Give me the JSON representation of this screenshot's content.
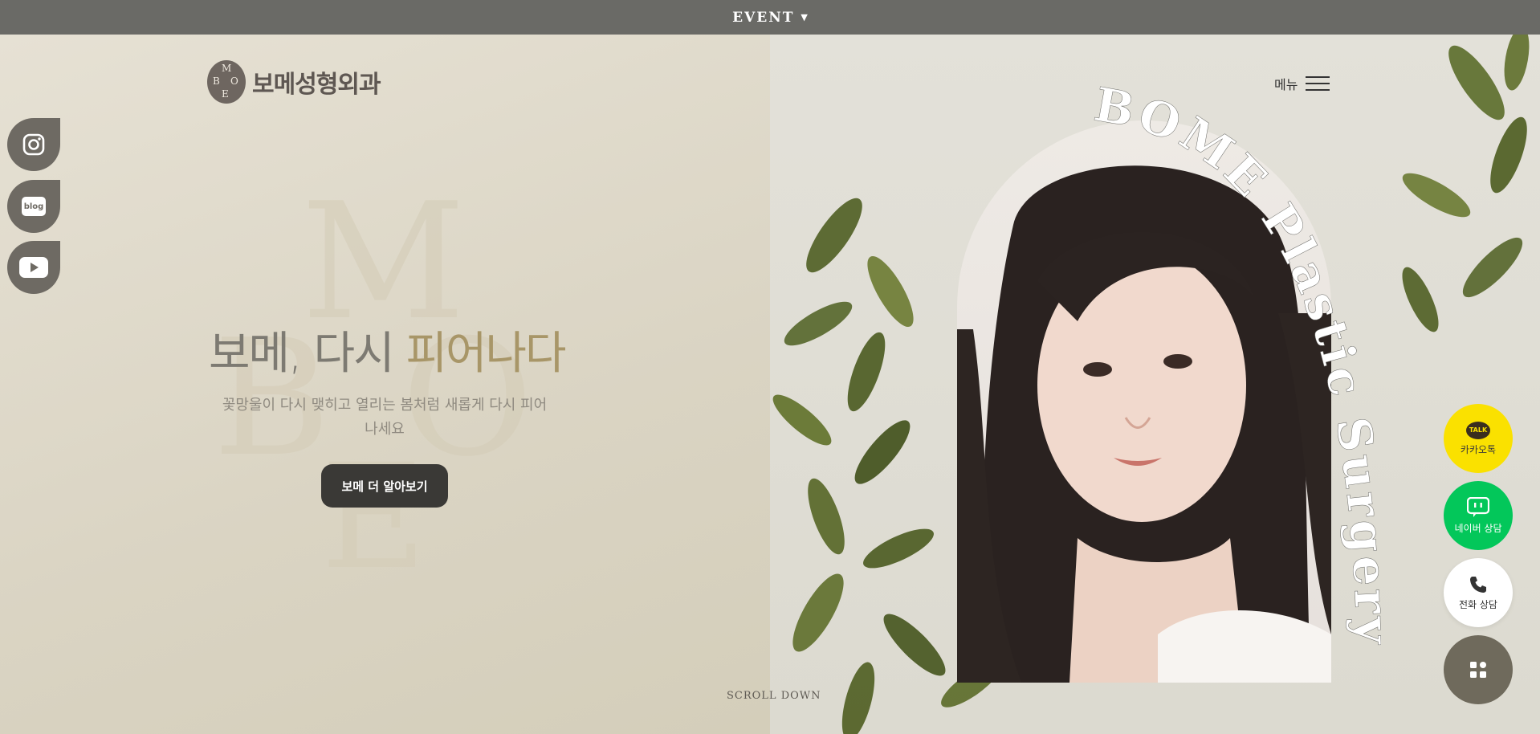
{
  "topbar": {
    "label": "EVENT"
  },
  "logo": {
    "mark_letters": [
      "M",
      "B",
      "O",
      "E"
    ],
    "name": "보메성형외과"
  },
  "menu": {
    "label": "메뉴"
  },
  "social": [
    {
      "icon": "instagram-icon"
    },
    {
      "icon": "blog-icon",
      "icon_text": "blog"
    },
    {
      "icon": "youtube-icon"
    }
  ],
  "hero": {
    "title_part1": "보메, 다시 ",
    "title_part2": "피어나다",
    "subtitle": "꽃망울이 다시 맺히고 열리는 봄처럼 새롭게 다시 피어나세요",
    "cta": "보메 더 알아보기"
  },
  "watermark": {
    "letters": [
      "M",
      "B",
      "O",
      "E"
    ]
  },
  "arc_text": "BOME Plastic Surgery",
  "scroll": {
    "label": "SCROLL DOWN"
  },
  "quick_menu": {
    "kakao": {
      "badge": "TALK",
      "label": "카카오톡"
    },
    "naver": {
      "label": "네이버 상담"
    },
    "phone": {
      "label": "전화 상담"
    }
  },
  "colors": {
    "topbar": "#6a6a66",
    "accent_gold": "#a89668",
    "kakao": "#fae100",
    "naver": "#03c75a",
    "dark_button": "#3a3936"
  }
}
